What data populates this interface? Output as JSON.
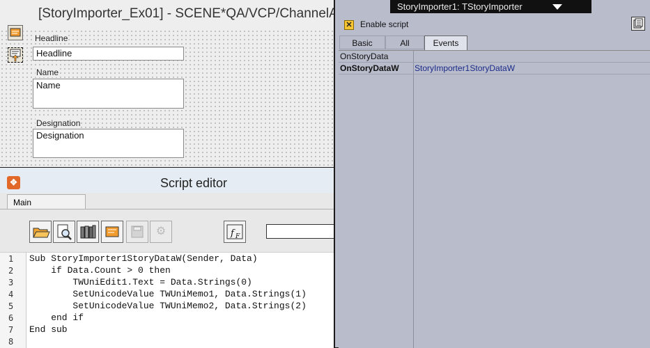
{
  "designer": {
    "title": "[StoryImporter_Ex01] - SCENE*QA/VCP/ChannelA",
    "fields": [
      {
        "label": "Headline",
        "value": "Headline"
      },
      {
        "label": "Name",
        "value": "Name"
      },
      {
        "label": "Designation",
        "value": "Designation"
      }
    ]
  },
  "inspector": {
    "title": "StoryImporter1: TStoryImporter",
    "enable_script_label": "Enable script",
    "enable_script_checked": true,
    "tabs": [
      "Basic",
      "All",
      "Events"
    ],
    "active_tab": "Events",
    "events": [
      {
        "name": "OnStoryData",
        "handler": ""
      },
      {
        "name": "OnStoryDataW",
        "handler": "StoryImporter1StoryDataW"
      }
    ]
  },
  "script_editor": {
    "title": "Script editor",
    "tab_label": "Main",
    "toolbar_icons": [
      "open-folder-icon",
      "find-icon",
      "library-icon",
      "form-icon",
      "save-icon",
      "settings-icon",
      "function-icon"
    ],
    "search_value": "",
    "code_lines": [
      {
        "n": "1",
        "text": "Sub StoryImporter1StoryDataW(Sender, Data)"
      },
      {
        "n": "2",
        "text": "    if Data.Count > 0 then"
      },
      {
        "n": "3",
        "text": "        TWUniEdit1.Text = Data.Strings(0)"
      },
      {
        "n": "4",
        "text": "        SetUnicodeValue TWUniMemo1, Data.Strings(1)"
      },
      {
        "n": "5",
        "text": "        SetUnicodeValue TWUniMemo2, Data.Strings(2)"
      },
      {
        "n": "6",
        "text": "    end if"
      },
      {
        "n": "7",
        "text": "End sub"
      },
      {
        "n": "8",
        "text": ""
      }
    ]
  }
}
